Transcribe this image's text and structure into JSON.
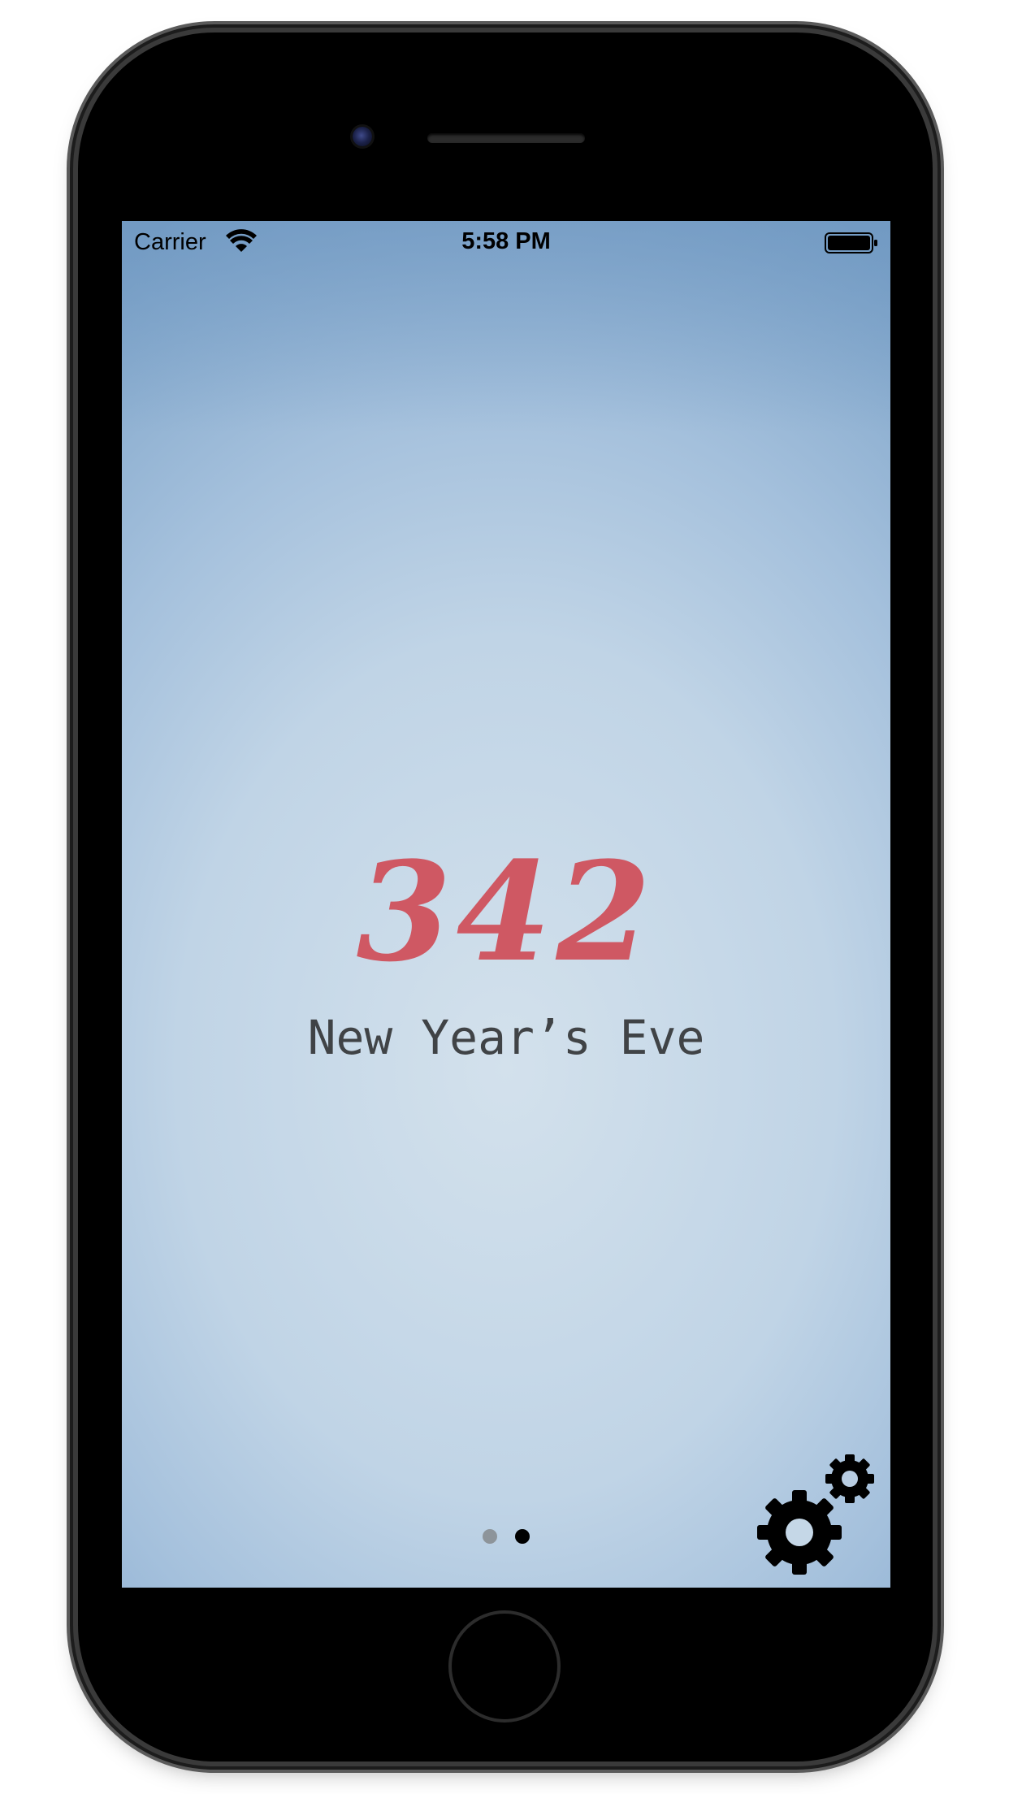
{
  "status_bar": {
    "carrier": "Carrier",
    "time": "5:58 PM",
    "wifi_icon": "wifi-icon",
    "battery_icon": "battery-icon"
  },
  "main": {
    "days_count": "342",
    "event_name": "New Year’s Eve"
  },
  "pager": {
    "page_count": 2,
    "current_page": 2
  },
  "settings": {
    "icon": "gears-icon"
  },
  "colors": {
    "counter": "#cf5863",
    "event_text": "#404346",
    "background_light": "#d3e1ec",
    "background_dark": "#7ea4c9"
  }
}
